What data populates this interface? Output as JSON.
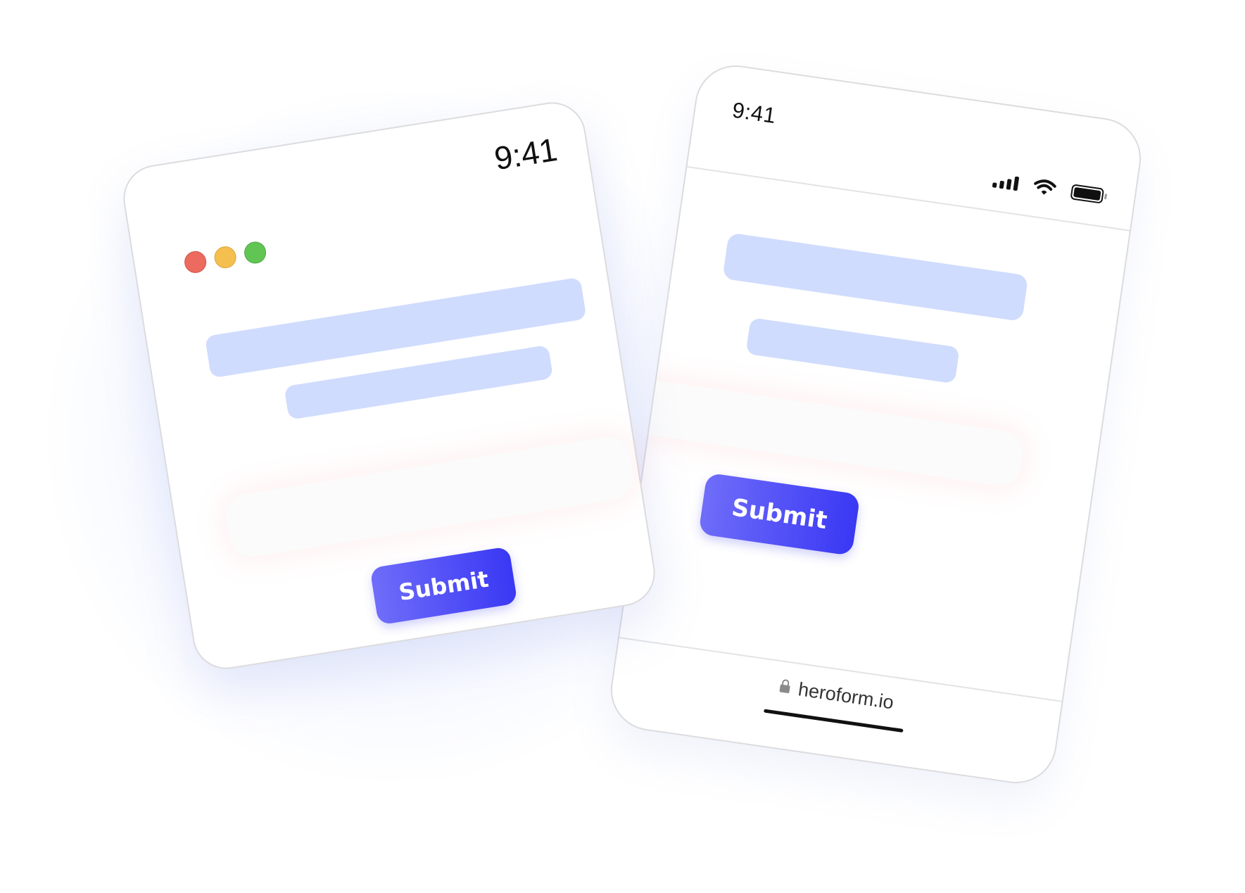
{
  "desktop_card": {
    "time": "9:41",
    "window_controls": [
      "close-icon",
      "minimize-icon",
      "maximize-icon"
    ],
    "submit_label": "Submit"
  },
  "mobile_card": {
    "time": "9:41",
    "status_icons": [
      "signal-icon",
      "wifi-icon",
      "battery-icon"
    ],
    "submit_label": "Submit",
    "url": "heroform.io"
  },
  "colors": {
    "accent_start": "#6f6df9",
    "accent_end": "#3a38f4",
    "placeholder_bar": "#d0dcfd",
    "close_dot": "#ec6a5e",
    "minimize_dot": "#f4bf4f",
    "maximize_dot": "#61c554"
  }
}
